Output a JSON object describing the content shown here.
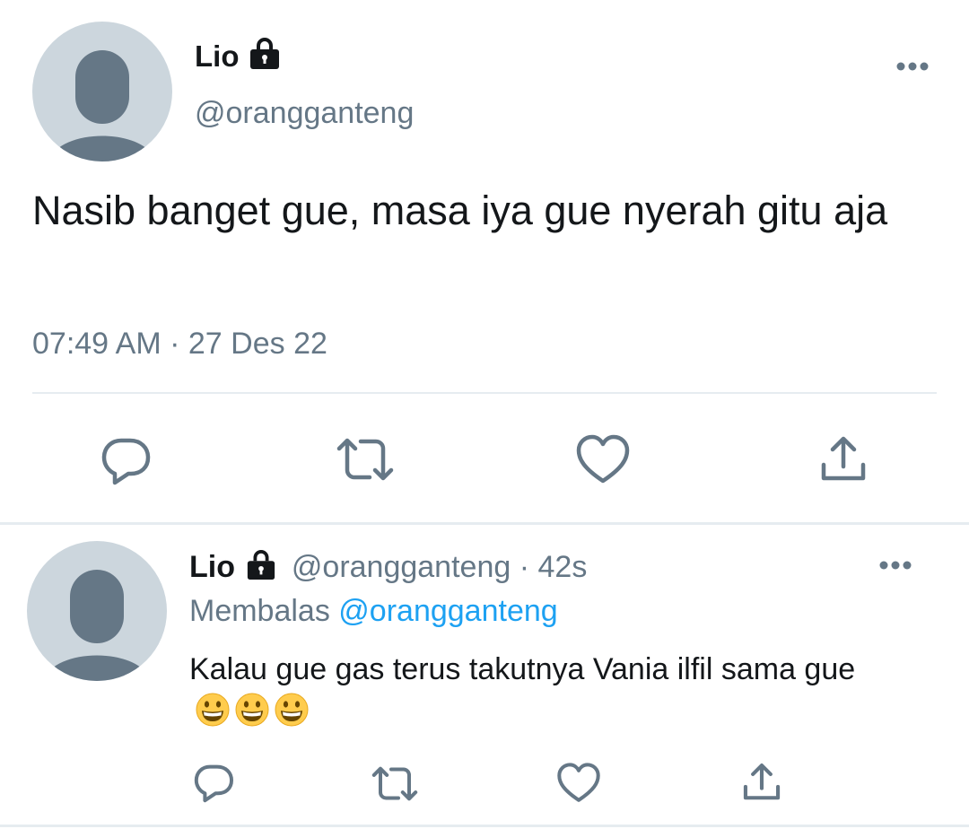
{
  "main_tweet": {
    "display_name": "Lio",
    "handle": "@orangganteng",
    "text": "Nasib banget gue, masa iya gue nyerah gitu aja",
    "time": "07:49 AM",
    "separator": "·",
    "date": "27 Des 22"
  },
  "reply_tweet": {
    "display_name": "Lio",
    "handle": "@orangganteng",
    "separator": "·",
    "age": "42s",
    "replying_prefix": "Membalas",
    "replying_to": "@orangganteng",
    "text": "Kalau gue gas terus takutnya Vania ilfil sama gue",
    "emojis": [
      "grinning-face-emoji",
      "grinning-face-emoji",
      "grinning-face-emoji"
    ]
  },
  "icons": {
    "lock": "lock-icon",
    "more": "more-icon",
    "reply": "reply-icon",
    "retweet": "retweet-icon",
    "like": "like-icon",
    "share": "share-icon"
  },
  "colors": {
    "text": "#14171a",
    "muted": "#657786",
    "link": "#1da1f2",
    "divider": "#e6ecf0",
    "avatar_bg": "#ccd6dd",
    "avatar_fg": "#657786"
  }
}
